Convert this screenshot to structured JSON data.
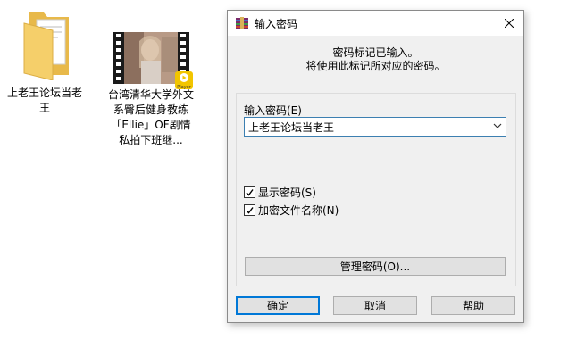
{
  "desktop": {
    "folder": {
      "label": "上老王论坛当老王",
      "icon": "folder-icon"
    },
    "video": {
      "label": "台湾清华大学外文系臀后健身教练「Ellie」OF剧情私拍下班继...",
      "icon": "video-thumbnail",
      "badge": "Player"
    }
  },
  "dialog": {
    "title": "输入密码",
    "info_line1": "密码标记已输入。",
    "info_line2": "将使用此标记所对应的密码。",
    "password_label": "输入密码(E)",
    "password_value": "上老王论坛当老王",
    "show_password_label": "显示密码(S)",
    "show_password_checked": true,
    "encrypt_names_label": "加密文件名称(N)",
    "encrypt_names_checked": true,
    "manage_button": "管理密码(O)...",
    "ok_button": "确定",
    "cancel_button": "取消",
    "help_button": "帮助"
  },
  "colors": {
    "accent": "#0078d7",
    "combo_border": "#3c7fb1",
    "folder_yellow": "#f5cf6a"
  }
}
